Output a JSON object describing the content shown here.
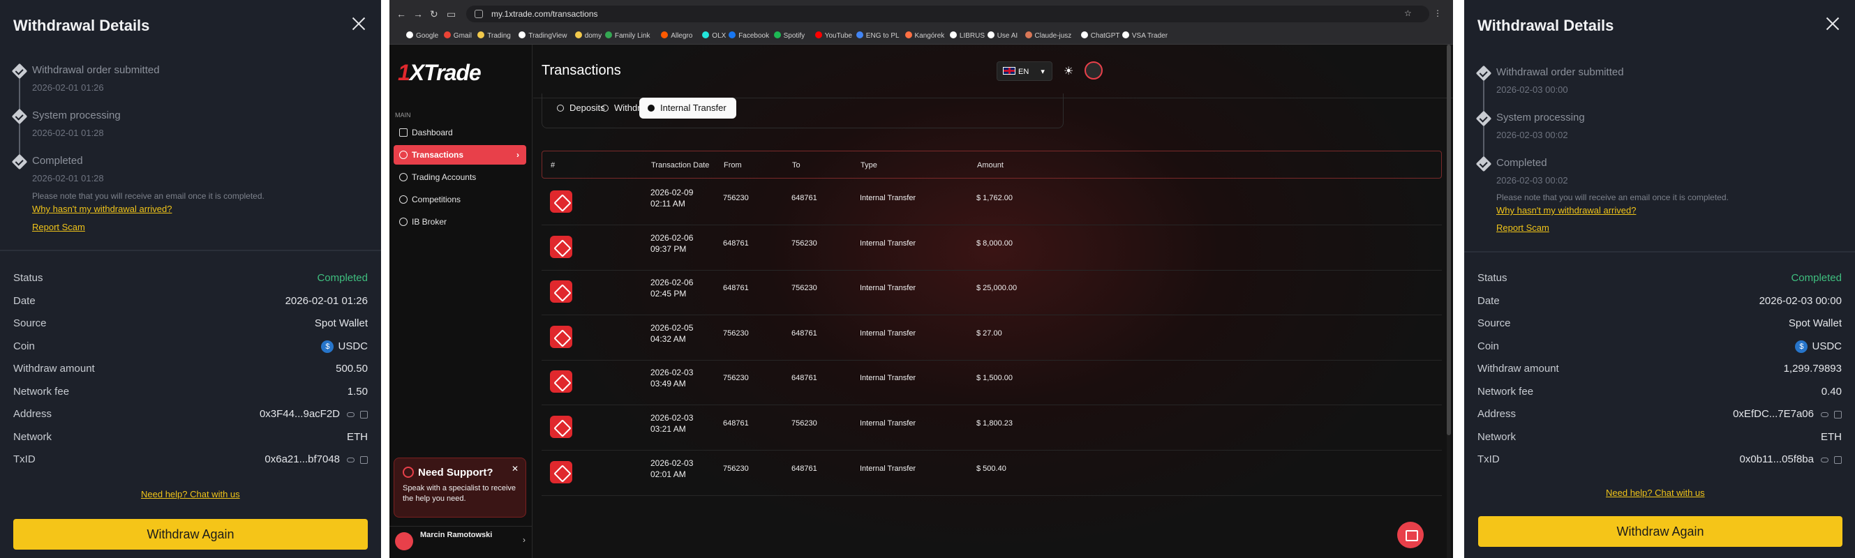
{
  "left_panel": {
    "title": "Withdrawal Details",
    "steps": [
      {
        "name": "Withdrawal order submitted",
        "time": "2026-02-01 01:26"
      },
      {
        "name": "System processing",
        "time": "2026-02-01 01:28"
      },
      {
        "name": "Completed",
        "time": "2026-02-01 01:28"
      }
    ],
    "note": "Please note that you will receive an email once it is completed.",
    "why_link": "Why hasn't my withdrawal arrived?",
    "report_link": "Report Scam",
    "rows": [
      {
        "key": "Status",
        "value": "Completed"
      },
      {
        "key": "Date",
        "value": "2026-02-01 01:26"
      },
      {
        "key": "Source",
        "value": "Spot Wallet"
      },
      {
        "key": "Coin",
        "value": "USDC"
      },
      {
        "key": "Withdraw amount",
        "value": "500.50"
      },
      {
        "key": "Network fee",
        "value": "1.50"
      },
      {
        "key": "Address",
        "value": "0x3F44...9acF2D"
      },
      {
        "key": "Network",
        "value": "ETH"
      },
      {
        "key": "TxID",
        "value": "0x6a21...bf7048"
      }
    ],
    "help_link": "Need help? Chat with us",
    "button": "Withdraw Again"
  },
  "right_panel": {
    "title": "Withdrawal Details",
    "steps": [
      {
        "name": "Withdrawal order submitted",
        "time": "2026-02-03 00:00"
      },
      {
        "name": "System processing",
        "time": "2026-02-03 00:02"
      },
      {
        "name": "Completed",
        "time": "2026-02-03 00:02"
      }
    ],
    "note": "Please note that you will receive an email once it is completed.",
    "why_link": "Why hasn't my withdrawal arrived?",
    "report_link": "Report Scam",
    "rows": [
      {
        "key": "Status",
        "value": "Completed"
      },
      {
        "key": "Date",
        "value": "2026-02-03 00:00"
      },
      {
        "key": "Source",
        "value": "Spot Wallet"
      },
      {
        "key": "Coin",
        "value": "USDC"
      },
      {
        "key": "Withdraw amount",
        "value": "1,299.79893"
      },
      {
        "key": "Network fee",
        "value": "0.40"
      },
      {
        "key": "Address",
        "value": "0xEfDC...7E7a06"
      },
      {
        "key": "Network",
        "value": "ETH"
      },
      {
        "key": "TxID",
        "value": "0x0b11...05f8ba"
      }
    ],
    "help_link": "Need help? Chat with us",
    "button": "Withdraw Again"
  },
  "browser": {
    "url": "my.1xtrade.com/transactions",
    "bookmarks": [
      {
        "label": "Google",
        "color": "#ffffff"
      },
      {
        "label": "Gmail",
        "color": "#ea4335"
      },
      {
        "label": "Trading",
        "color": "#f2c94c"
      },
      {
        "label": "TradingView",
        "color": "#ffffff"
      },
      {
        "label": "domy",
        "color": "#f2c94c"
      },
      {
        "label": "Family Link",
        "color": "#34a853"
      },
      {
        "label": "Allegro",
        "color": "#ff5a00"
      },
      {
        "label": "OLX",
        "color": "#23e5db"
      },
      {
        "label": "Facebook",
        "color": "#1877f2"
      },
      {
        "label": "Spotify",
        "color": "#1db954"
      },
      {
        "label": "YouTube",
        "color": "#ff0000"
      },
      {
        "label": "ENG to PL",
        "color": "#4285f4"
      },
      {
        "label": "Kangórek",
        "color": "#ff7043"
      },
      {
        "label": "LIBRUS",
        "color": "#ffffff"
      },
      {
        "label": "Use AI",
        "color": "#ffffff"
      },
      {
        "label": "Claude-jusz",
        "color": "#d97757"
      },
      {
        "label": "ChatGPT",
        "color": "#ffffff"
      },
      {
        "label": "VSA Trader",
        "color": "#ffffff"
      }
    ]
  },
  "app": {
    "logo_accent": "1",
    "logo_text": "XTrade",
    "page_title": "Transactions",
    "lang": "EN",
    "nav_section": "MAIN",
    "nav": [
      {
        "label": "Dashboard"
      },
      {
        "label": "Transactions"
      },
      {
        "label": "Trading Accounts"
      },
      {
        "label": "Competitions"
      },
      {
        "label": "IB Broker"
      }
    ],
    "tabs": [
      {
        "label": "Deposits"
      },
      {
        "label": "Withdraw"
      },
      {
        "label": "Internal Transfer"
      }
    ],
    "columns": [
      "#",
      "Transaction Date",
      "From",
      "To",
      "Type",
      "Amount"
    ],
    "rows": [
      {
        "date": "2026-02-09",
        "time": "02:11 AM",
        "from": "756230",
        "to": "648761",
        "type": "Internal Transfer",
        "amount": "$ 1,762.00"
      },
      {
        "date": "2026-02-06",
        "time": "09:37 PM",
        "from": "648761",
        "to": "756230",
        "type": "Internal Transfer",
        "amount": "$ 8,000.00"
      },
      {
        "date": "2026-02-06",
        "time": "02:45 PM",
        "from": "648761",
        "to": "756230",
        "type": "Internal Transfer",
        "amount": "$ 25,000.00"
      },
      {
        "date": "2026-02-05",
        "time": "04:32 AM",
        "from": "756230",
        "to": "648761",
        "type": "Internal Transfer",
        "amount": "$ 27.00"
      },
      {
        "date": "2026-02-03",
        "time": "03:49 AM",
        "from": "756230",
        "to": "648761",
        "type": "Internal Transfer",
        "amount": "$ 1,500.00"
      },
      {
        "date": "2026-02-03",
        "time": "03:21 AM",
        "from": "648761",
        "to": "756230",
        "type": "Internal Transfer",
        "amount": "$ 1,800.23"
      },
      {
        "date": "2026-02-03",
        "time": "02:01 AM",
        "from": "756230",
        "to": "648761",
        "type": "Internal Transfer",
        "amount": "$ 500.40"
      }
    ],
    "support": {
      "title": "Need Support?",
      "desc": "Speak with a specialist to receive the help you need."
    },
    "user_name": "Marcin Ramotowski"
  }
}
